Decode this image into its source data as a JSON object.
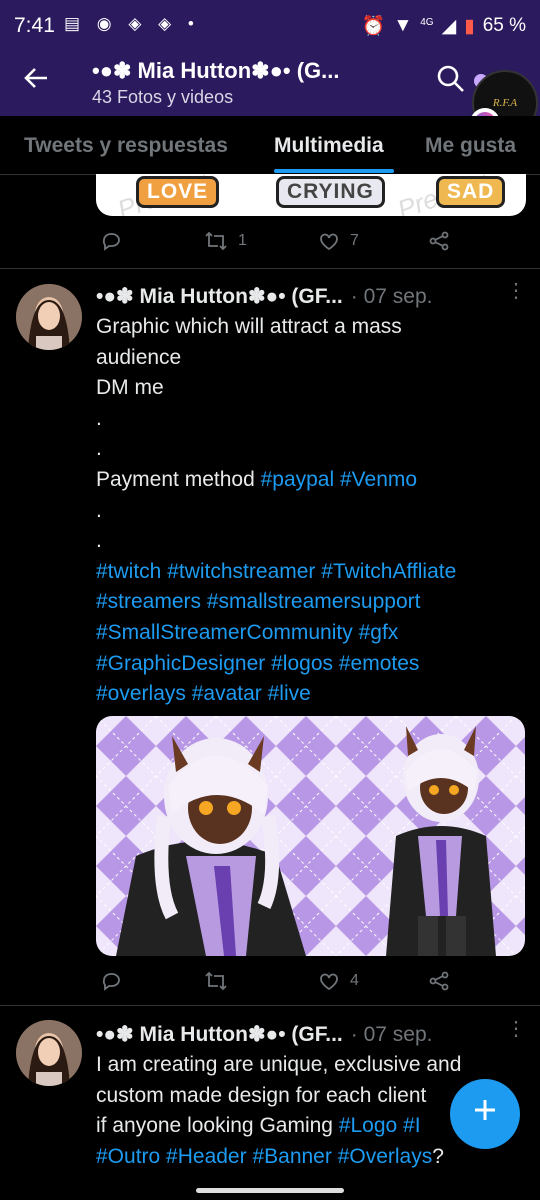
{
  "status_bar": {
    "time": "7:41",
    "network": "4G",
    "battery": "65 %"
  },
  "header": {
    "title": "•●✽ Mia Hutton✽●• (G...",
    "subtitle": "43 Fotos y videos"
  },
  "tabs": [
    {
      "label": "Tweets y respuestas",
      "active": false
    },
    {
      "label": "Multimedia",
      "active": true
    },
    {
      "label": "Me gusta",
      "active": false
    }
  ],
  "prev_tweet": {
    "stickers": [
      "LOVE",
      "CRYING",
      "SAD"
    ],
    "retweets": "1",
    "likes": "7"
  },
  "tweets": [
    {
      "author": "•●✽ Mia Hutton✽●• (GF...",
      "date": "· 07 sep.",
      "lines": [
        [
          {
            "t": "Graphic which will attract a mass"
          }
        ],
        [
          {
            "t": "audience"
          }
        ],
        [
          {
            "t": "DM me"
          }
        ],
        [
          {
            "t": "."
          }
        ],
        [
          {
            "t": "."
          }
        ],
        [
          {
            "t": "Payment method "
          },
          {
            "t": "#paypal",
            "h": true
          },
          {
            "t": " "
          },
          {
            "t": "#Venmo",
            "h": true
          }
        ],
        [
          {
            "t": "."
          }
        ],
        [
          {
            "t": "."
          }
        ],
        [
          {
            "t": "#twitch",
            "h": true
          },
          {
            "t": " "
          },
          {
            "t": "#twitchstreamer",
            "h": true
          },
          {
            "t": " "
          },
          {
            "t": "#TwitchAffliate",
            "h": true
          }
        ],
        [
          {
            "t": "#streamers",
            "h": true
          },
          {
            "t": " "
          },
          {
            "t": "#smallstreamersupport",
            "h": true
          }
        ],
        [
          {
            "t": "#SmallStreamerCommunity",
            "h": true
          },
          {
            "t": " "
          },
          {
            "t": "#gfx",
            "h": true
          }
        ],
        [
          {
            "t": "#GraphicDesigner",
            "h": true
          },
          {
            "t": " "
          },
          {
            "t": "#logos",
            "h": true
          },
          {
            "t": " "
          },
          {
            "t": "#emotes",
            "h": true
          }
        ],
        [
          {
            "t": "#overlays",
            "h": true
          },
          {
            "t": " "
          },
          {
            "t": "#avatar",
            "h": true
          },
          {
            "t": " "
          },
          {
            "t": "#live",
            "h": true
          }
        ]
      ],
      "replies": "",
      "retweets": "",
      "likes": "4"
    },
    {
      "author": "•●✽ Mia Hutton✽●• (GF...",
      "date": "· 07 sep.",
      "lines": [
        [
          {
            "t": "I am creating are unique, exclusive and"
          }
        ],
        [
          {
            "t": "custom made design for each client"
          }
        ],
        [
          {
            "t": "if anyone looking Gaming "
          },
          {
            "t": "#Logo",
            "h": true
          },
          {
            "t": " "
          },
          {
            "t": "#I",
            "h": true
          }
        ],
        [
          {
            "t": "#Outro",
            "h": true
          },
          {
            "t": " "
          },
          {
            "t": "#Header",
            "h": true
          },
          {
            "t": " "
          },
          {
            "t": "#Banner",
            "h": true
          },
          {
            "t": " "
          },
          {
            "t": "#Overlays",
            "h": true
          },
          {
            "t": "?"
          }
        ]
      ]
    }
  ],
  "badge_text": "R.F.A",
  "colors": {
    "header_bg": "#2b1a5e",
    "link": "#1d9bf0",
    "muted": "#71767b",
    "text": "#e7e9ea"
  }
}
